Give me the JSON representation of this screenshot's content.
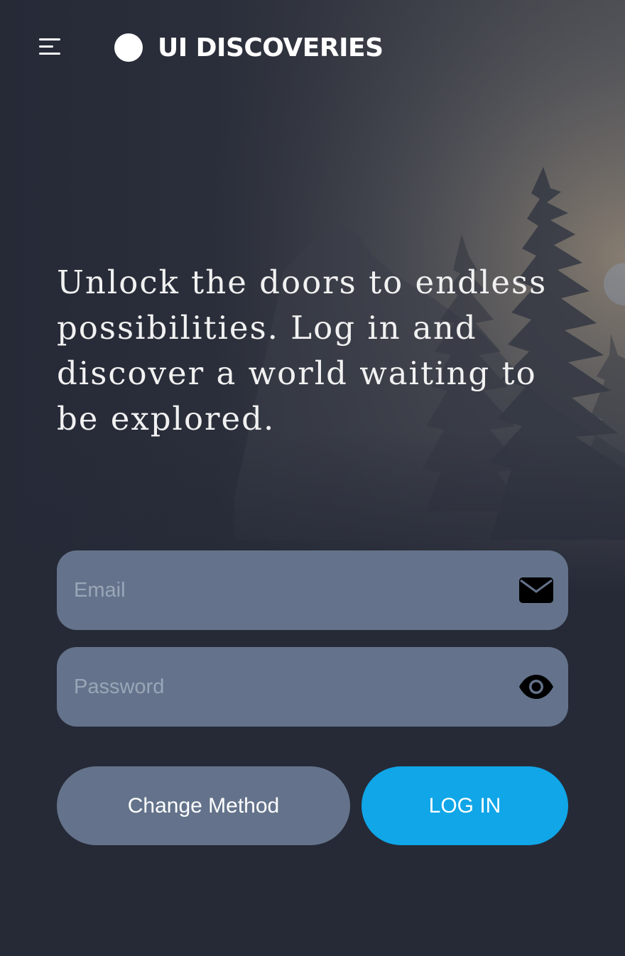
{
  "header": {
    "brand": "UI DISCOVERIES",
    "icons": {
      "menu": "hamburger-menu-icon",
      "logo": "circle-logo-icon"
    }
  },
  "hero": {
    "headline": "Unlock the doors to endless possibilities. Log in and discover a world waiting to be explored."
  },
  "form": {
    "email": {
      "placeholder": "Email",
      "value": "",
      "icon": "envelope-icon"
    },
    "password": {
      "placeholder": "Password",
      "value": "",
      "icon": "eye-icon"
    },
    "change_method_label": "Change Method",
    "login_label": "LOG IN"
  },
  "colors": {
    "background": "#262a37",
    "field": "#64738b",
    "accent": "#10a6e8",
    "text": "#ffffff"
  }
}
